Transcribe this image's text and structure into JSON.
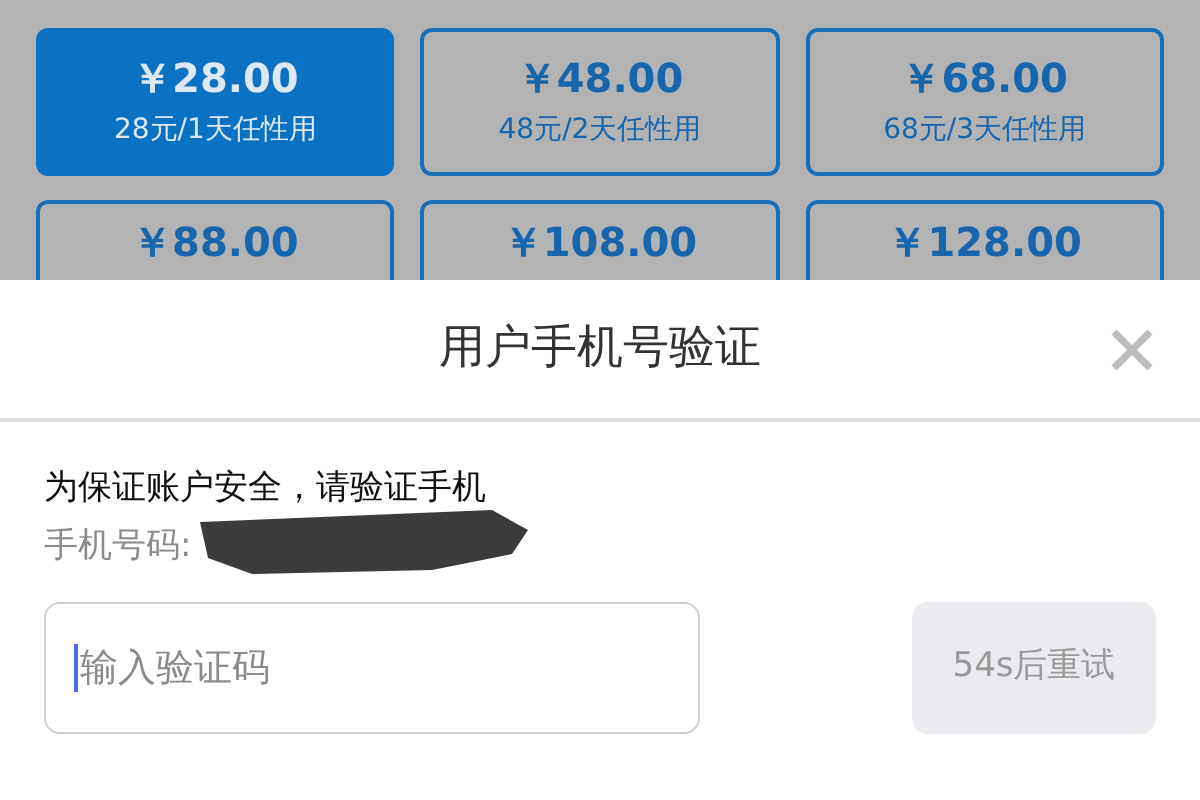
{
  "plans": [
    {
      "price": "￥28.00",
      "subtitle": "28元/1天任性用",
      "selected": true
    },
    {
      "price": "￥48.00",
      "subtitle": "48元/2天任性用",
      "selected": false
    },
    {
      "price": "￥68.00",
      "subtitle": "68元/3天任性用",
      "selected": false
    },
    {
      "price": "￥88.00",
      "selected": false
    },
    {
      "price": "￥108.00",
      "selected": false
    },
    {
      "price": "￥128.00",
      "selected": false
    }
  ],
  "dialog": {
    "title": "用户手机号验证",
    "message": "为保证账户安全，请验证手机",
    "phone_label": "手机号码:",
    "code_field": {
      "placeholder": "输入验证码"
    },
    "resend_button": {
      "label": "54s后重试",
      "disabled": true
    }
  }
}
